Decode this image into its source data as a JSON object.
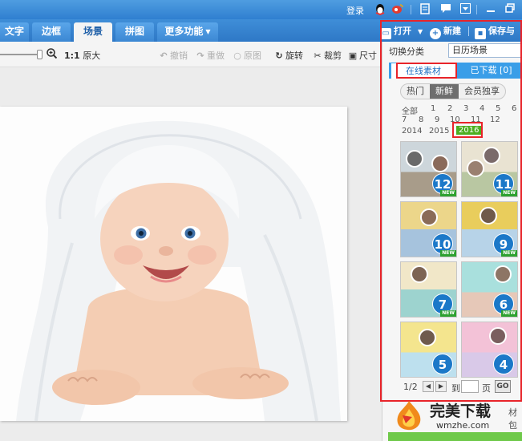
{
  "titlebar": {
    "login_label": "登录"
  },
  "tabs": [
    {
      "label": "文字"
    },
    {
      "label": "边框"
    },
    {
      "label": "场景",
      "active": true
    },
    {
      "label": "拼图"
    },
    {
      "label": "更多功能"
    }
  ],
  "top_actions": {
    "open": "打开",
    "new": "新建",
    "save": "保存与分"
  },
  "toolbar": {
    "zoom_ratio": "1:1",
    "original_size": "原大",
    "undo": "撤销",
    "redo": "重做",
    "original": "原图",
    "rotate": "旋转",
    "crop": "裁剪",
    "resize": "尺寸"
  },
  "panel": {
    "category_label": "切换分类",
    "category_value": "日历场景",
    "tab_online": "在线素材",
    "tab_downloaded": "已下载 [0]",
    "segments": [
      "热门",
      "新鲜",
      "会员独享"
    ],
    "filters": [
      "全部",
      "1",
      "2",
      "3",
      "4",
      "5",
      "6",
      "7",
      "8",
      "9",
      "10",
      "11",
      "12",
      "2014",
      "2015",
      "2016"
    ],
    "selected_filter": "2016",
    "thumbnails": [
      "12",
      "11",
      "10",
      "9",
      "7",
      "6",
      "5",
      "4"
    ],
    "new_badge": "NEW",
    "pager": {
      "page": "1/2",
      "goto": "到",
      "unit": "页",
      "go": "GO"
    }
  },
  "watermark": {
    "brand": "完美下载",
    "url": "wmzhe.com",
    "cut_text": "材包"
  },
  "colors": {
    "titlebar": "#2f7fd0",
    "highlight": "#e8242a",
    "selected_green": "#4cae20",
    "number_blue": "#1b78c8"
  }
}
